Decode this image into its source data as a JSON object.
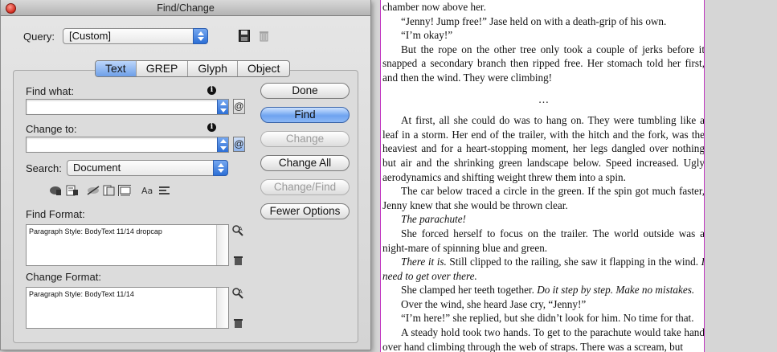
{
  "dialog": {
    "title": "Find/Change",
    "query": {
      "label": "Query:",
      "value": "[Custom]"
    },
    "tabs": [
      {
        "label": "Text",
        "selected": true
      },
      {
        "label": "GREP",
        "selected": false
      },
      {
        "label": "Glyph",
        "selected": false
      },
      {
        "label": "Object",
        "selected": false
      }
    ],
    "find_what": {
      "label": "Find what:",
      "value": ""
    },
    "change_to": {
      "label": "Change to:",
      "value": ""
    },
    "search": {
      "label": "Search:",
      "value": "Document"
    },
    "buttons": {
      "done": "Done",
      "find": "Find",
      "change": "Change",
      "change_all": "Change All",
      "change_find": "Change/Find",
      "fewer_options": "Fewer Options"
    },
    "find_format": {
      "label": "Find Format:",
      "value": "Paragraph Style: BodyText 11/14 dropcap"
    },
    "change_format": {
      "label": "Change Format:",
      "value": "Paragraph Style: BodyText 11/14"
    },
    "option_icons": [
      "locked-layers-icon",
      "locked-stories-icon",
      "hidden-layers-icon",
      "master-pages-icon",
      "footnotes-icon",
      "case-sensitive-icon",
      "whole-word-icon"
    ],
    "accent_color": "#3f7fe0"
  },
  "document": {
    "paragraphs": [
      {
        "text": "chamber now above her.",
        "indent": false
      },
      {
        "text": "“Jenny! Jump free!” Jase held on with a death-grip of his own.",
        "indent": true
      },
      {
        "text": "“I’m okay!”",
        "indent": true
      },
      {
        "text": "But the rope on the other tree only took a couple of jerks before it snapped a secondary branch then ripped free. Her stomach told her first, and then the wind. They were climbing!",
        "indent": true
      },
      {
        "text": "…",
        "separator": true
      },
      {
        "text": "At first, all she could do was to hang on. They were tumbling like a leaf in a storm. Her end of the trailer, with the hitch and the fork, was the heaviest and for a heart-stopping moment, her legs dangled over nothing but air and the shrinking green landscape below. Speed increased. Ugly aerodynamics and shifting weight threw them into a spin.",
        "indent": true
      },
      {
        "text": "The car below traced a circle in the green. If the spin got much faster, Jenny knew that she would be thrown clear.",
        "indent": true
      },
      {
        "text": "The parachute!",
        "indent": true,
        "italic": true
      },
      {
        "text": "She forced herself to focus on the trailer. The world outside was a night-mare of spinning blue and green.",
        "indent": true
      },
      {
        "text": "There it is. Still clipped to the railing, she saw it flapping in the wind. I need to get over there.",
        "indent": true,
        "mixed": "italic-start"
      },
      {
        "text": "She clamped her teeth together. Do it step by step. Make no mistakes.",
        "indent": true,
        "mixed": "italic-end"
      },
      {
        "text": "Over the wind, she heard Jase cry, “Jenny!”",
        "indent": true
      },
      {
        "text": "“I’m here!” she replied, but she didn’t look for him. No time for that.",
        "indent": true
      },
      {
        "text": "A steady hold took two hands. To get to the parachute would take hand over hand climbing through the web of straps. There was a scream, but",
        "indent": true
      }
    ],
    "top_line_fragment": "grasp ... chamber now above her.",
    "border_color": "#c036c0"
  }
}
